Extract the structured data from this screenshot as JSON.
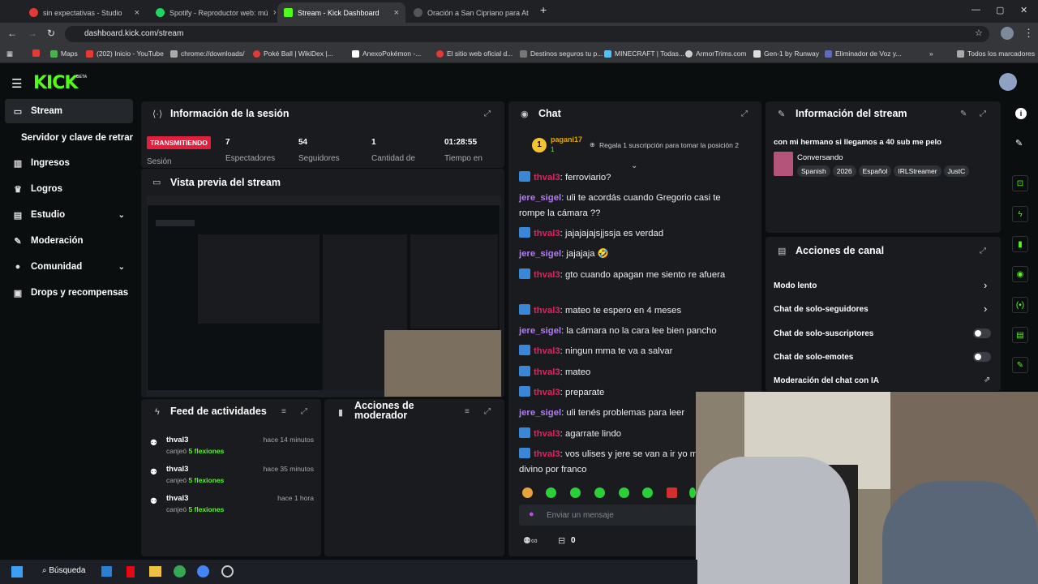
{
  "browser": {
    "tabs": [
      {
        "title": "sin expectativas - Studio",
        "color": "#e53935"
      },
      {
        "title": "Spotify - Reproductor web: mú",
        "color": "#1ed760"
      },
      {
        "title": "Stream - Kick Dashboard",
        "color": "#53fc18"
      },
      {
        "title": "Oración a San Cipriano para At",
        "color": "#333333"
      }
    ],
    "url": "dashboard.kick.com/stream",
    "bookmarks": [
      "Maps",
      "(202) Inicio - YouTube",
      "chrome://downloads/",
      "Poké Ball | WikiDex |...",
      "AnexoPokémon -...",
      "El sitio web oficial d...",
      "Destinos seguros tu p...",
      "MINECRAFT | Todas...",
      "ArmorTrims.com",
      "Gen-1 by Runway",
      "Eliminador de Voz y...",
      "Todos los marcadores"
    ]
  },
  "kick": {
    "logo": "KICK",
    "logo_tag": "BETA",
    "sidebar": [
      {
        "label": "Stream",
        "icon": "stream-icon",
        "selected": true
      },
      {
        "label": "Servidor y clave de retransmisión",
        "icon": "",
        "selected": false
      },
      {
        "label": "Ingresos",
        "icon": "chart-icon",
        "selected": false
      },
      {
        "label": "Logros",
        "icon": "trophy-icon",
        "selected": false
      },
      {
        "label": "Estudio",
        "icon": "studio-icon",
        "selected": false,
        "chevron": true
      },
      {
        "label": "Moderación",
        "icon": "wrench-icon",
        "selected": false
      },
      {
        "label": "Comunidad",
        "icon": "users-icon",
        "selected": false,
        "chevron": true
      },
      {
        "label": "Drops y recompensas",
        "icon": "gift-icon",
        "selected": false
      }
    ],
    "session": {
      "title": "Información de la sesión",
      "live_badge": "TRANSMITIENDO",
      "session_label": "Sesión",
      "stats": [
        {
          "value": "7",
          "label": "Espectadores"
        },
        {
          "value": "54",
          "label": "Seguidores"
        },
        {
          "value": "1",
          "label": "Cantidad de"
        },
        {
          "value": "01:28:55",
          "label": "Tiempo en"
        }
      ]
    },
    "preview": {
      "title": "Vista previa del stream"
    },
    "feed": {
      "title": "Feed de actividades",
      "items": [
        {
          "user": "thval3",
          "action": "canjeó",
          "reward": "5 flexiones",
          "time": "hace 14 minutos"
        },
        {
          "user": "thval3",
          "action": "canjeó",
          "reward": "5 flexiones",
          "time": "hace 35 minutos"
        },
        {
          "user": "thval3",
          "action": "canjeó",
          "reward": "5 flexiones",
          "time": "hace 1 hora"
        }
      ]
    },
    "mod_actions": {
      "title": "Acciones de moderador"
    },
    "chat": {
      "title": "Chat",
      "top_gifter": "pagani17",
      "top_gifter_count": "1",
      "gift_prompt": "Regala 1 suscripción para tomar la posición 2",
      "messages": [
        {
          "user": "thval3",
          "text": "ferroviario?",
          "type": "u1"
        },
        {
          "user": "jere_sigel",
          "text": "uli te acordás cuando Gregorio casi te rompe la cámara ??",
          "type": "u2"
        },
        {
          "user": "thval3",
          "text": "jajajajajsjjssja es verdad",
          "type": "u1"
        },
        {
          "user": "jere_sigel",
          "text": "jajajaja 🤣",
          "type": "u2"
        },
        {
          "user": "thval3",
          "text": "gto cuando apagan me siento re afuera",
          "type": "u1"
        },
        {
          "user": "thval3",
          "text": "mateo te espero en 4 meses",
          "type": "u1"
        },
        {
          "user": "jere_sigel",
          "text": "la cámara no la cara lee bien pancho",
          "type": "u2"
        },
        {
          "user": "thval3",
          "text": "ningun mma te va a salvar",
          "type": "u1"
        },
        {
          "user": "thval3",
          "text": "mateo",
          "type": "u1"
        },
        {
          "user": "thval3",
          "text": "preparate",
          "type": "u1"
        },
        {
          "user": "jere_sigel",
          "text": "uli tenés problemas para leer",
          "type": "u2"
        },
        {
          "user": "thval3",
          "text": "agarrate lindo",
          "type": "u1"
        },
        {
          "user": "thval3",
          "text": "vos ulises y jere se van a ir yo me voy a ir divino por franco",
          "type": "u1"
        }
      ],
      "input_placeholder": "Enviar un mensaje",
      "footer_count": "0"
    },
    "stream_info": {
      "title": "Información del stream",
      "stream_title": "con mi hermano si llegamos a 40 sub me pelo",
      "category": "Conversando",
      "tags": [
        "Spanish",
        "2026",
        "Español",
        "IRLStreamer",
        "JustC"
      ]
    },
    "channel_actions": {
      "title": "Acciones de canal",
      "items": [
        {
          "label": "Modo lento",
          "control": "chevron"
        },
        {
          "label": "Chat de solo-seguidores",
          "control": "chevron"
        },
        {
          "label": "Chat de solo-suscriptores",
          "control": "toggle"
        },
        {
          "label": "Chat de solo-emotes",
          "control": "toggle"
        },
        {
          "label": "Moderación del chat con IA",
          "control": "external"
        }
      ]
    }
  },
  "taskbar": {
    "search_label": "Búsqueda"
  }
}
